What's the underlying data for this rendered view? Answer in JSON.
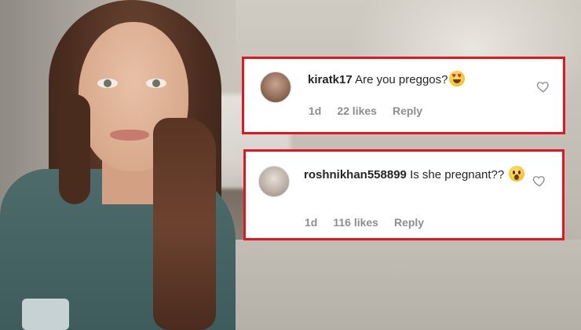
{
  "comments": [
    {
      "username": "kiratk17",
      "text": "Are you preggos?",
      "emoji": "smiling-face-with-heart-eyes",
      "time": "1d",
      "likes": "22 likes",
      "reply_label": "Reply"
    },
    {
      "username": "roshnikhan558899",
      "text": "Is she pregnant??",
      "emoji": "face-with-open-mouth",
      "time": "1d",
      "likes": "116 likes",
      "reply_label": "Reply"
    }
  ],
  "colors": {
    "highlight_border": "#e3151d",
    "username_text": "#262626",
    "meta_text": "#8e8e8e"
  }
}
